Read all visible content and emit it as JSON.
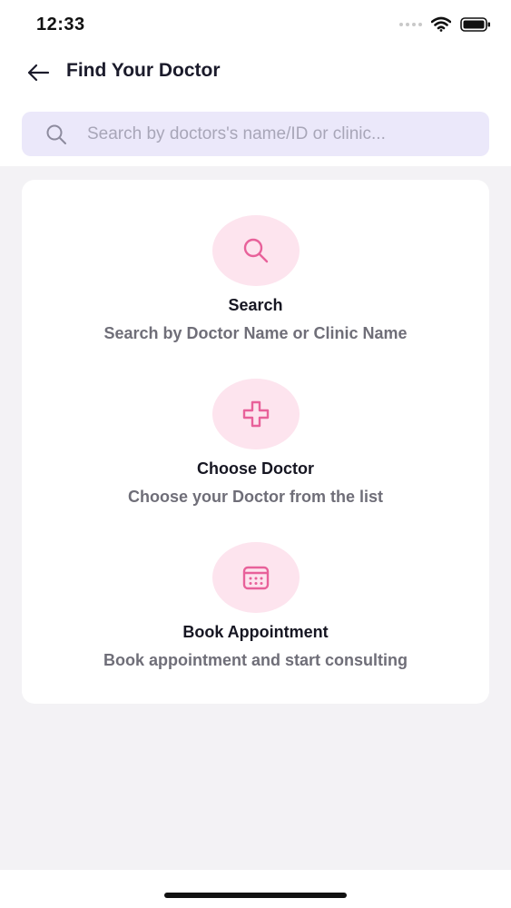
{
  "status_bar": {
    "time": "12:33"
  },
  "header": {
    "title": "Find Your Doctor"
  },
  "search": {
    "placeholder": "Search by doctors's name/ID or clinic..."
  },
  "steps": [
    {
      "icon": "search-icon",
      "title": "Search",
      "description": "Search by Doctor Name or Clinic Name"
    },
    {
      "icon": "medical-cross-icon",
      "title": "Choose Doctor",
      "description": "Choose your Doctor from the list"
    },
    {
      "icon": "calendar-icon",
      "title": "Book Appointment",
      "description": "Book appointment and start consulting"
    }
  ],
  "colors": {
    "accent_pink": "#e8619a",
    "icon_circle": "#fde4ee",
    "search_bg": "#ebe8fa",
    "page_bg": "#f3f2f5"
  }
}
